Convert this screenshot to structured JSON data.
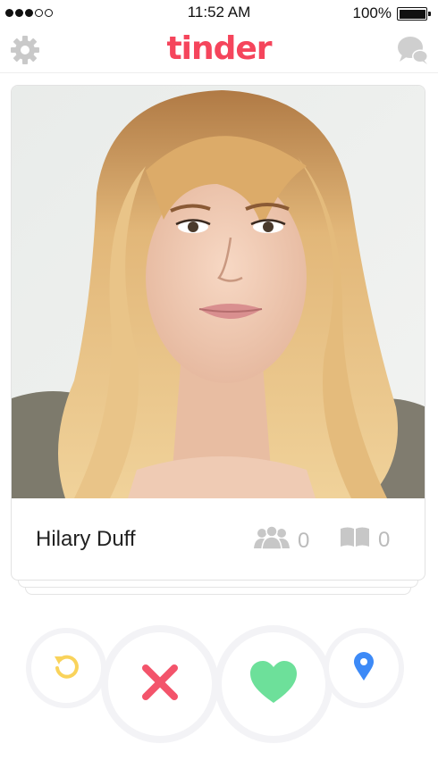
{
  "status_bar": {
    "time": "11:52 AM",
    "battery_percent": "100%",
    "signal_bars_filled": 3,
    "signal_bars_total": 5
  },
  "header": {
    "logo_text": "tinder",
    "left_icon": "gear-icon",
    "right_icon": "chat-bubbles-icon"
  },
  "profile_card": {
    "name": "Hilary Duff",
    "photo": "profile-photo",
    "common_friends_icon": "people-icon",
    "common_friends": "0",
    "common_interests_icon": "book-icon",
    "common_interests": "0"
  },
  "actions": [
    {
      "name": "rewind",
      "icon": "rewind-icon",
      "color": "#f9d35b"
    },
    {
      "name": "nope",
      "icon": "x-icon",
      "color": "#f3546b"
    },
    {
      "name": "like",
      "icon": "heart-icon",
      "color": "#6de09a"
    },
    {
      "name": "location",
      "icon": "location-pin-icon",
      "color": "#3d8af7"
    }
  ],
  "colors": {
    "brand": "#f5455c",
    "icon_gray": "#c7c7c7",
    "button_ring": "#f3f3f6"
  }
}
